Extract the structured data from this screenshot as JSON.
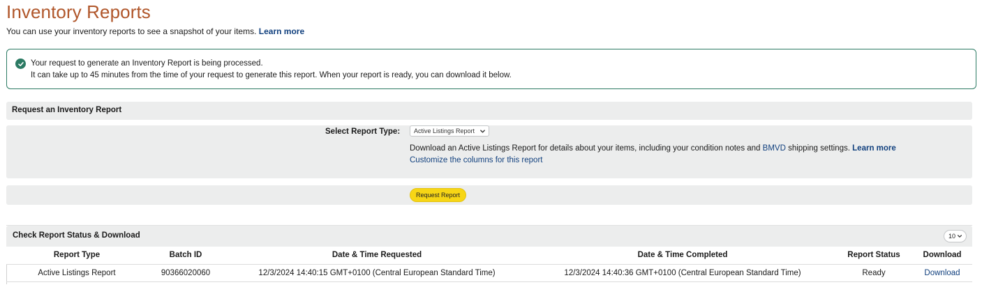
{
  "header": {
    "title": "Inventory Reports",
    "subtitle": "You can use your inventory reports to see a snapshot of your items.",
    "learn_more": "Learn more"
  },
  "alert": {
    "line1": "Your request to generate an Inventory Report is being processed.",
    "line2": "It can take up to 45 minutes from the time of your request to generate this report. When your report is ready, you can download it below.",
    "icon": "check-circle-icon",
    "color": "#2b7a63"
  },
  "request_panel": {
    "title": "Request an Inventory Report",
    "select_label": "Select Report Type:",
    "select_value": "Active Listings Report",
    "desc_before": "Download an Active Listings Report for details about your items, including your condition notes and ",
    "desc_link": "BMVD",
    "desc_after": " shipping settings. ",
    "desc_learn_more": "Learn more",
    "customize": "Customize the columns for this report",
    "request_button": "Request Report"
  },
  "status_panel": {
    "title": "Check Report Status & Download",
    "page_size": "10",
    "columns": [
      "Report Type",
      "Batch ID",
      "Date & Time Requested",
      "Date & Time Completed",
      "Report Status",
      "Download"
    ],
    "rows": [
      {
        "report_type": "Active Listings Report",
        "batch_id": "90366020060",
        "requested": "12/3/2024 14:40:15 GMT+0100 (Central European Standard Time)",
        "completed": "12/3/2024 14:40:36 GMT+0100 (Central European Standard Time)",
        "status": "Ready",
        "download": "Download"
      }
    ]
  },
  "colors": {
    "title": "#b0562a",
    "link": "#11407e",
    "button": "#f7d615",
    "panel_bg": "#eceded"
  }
}
